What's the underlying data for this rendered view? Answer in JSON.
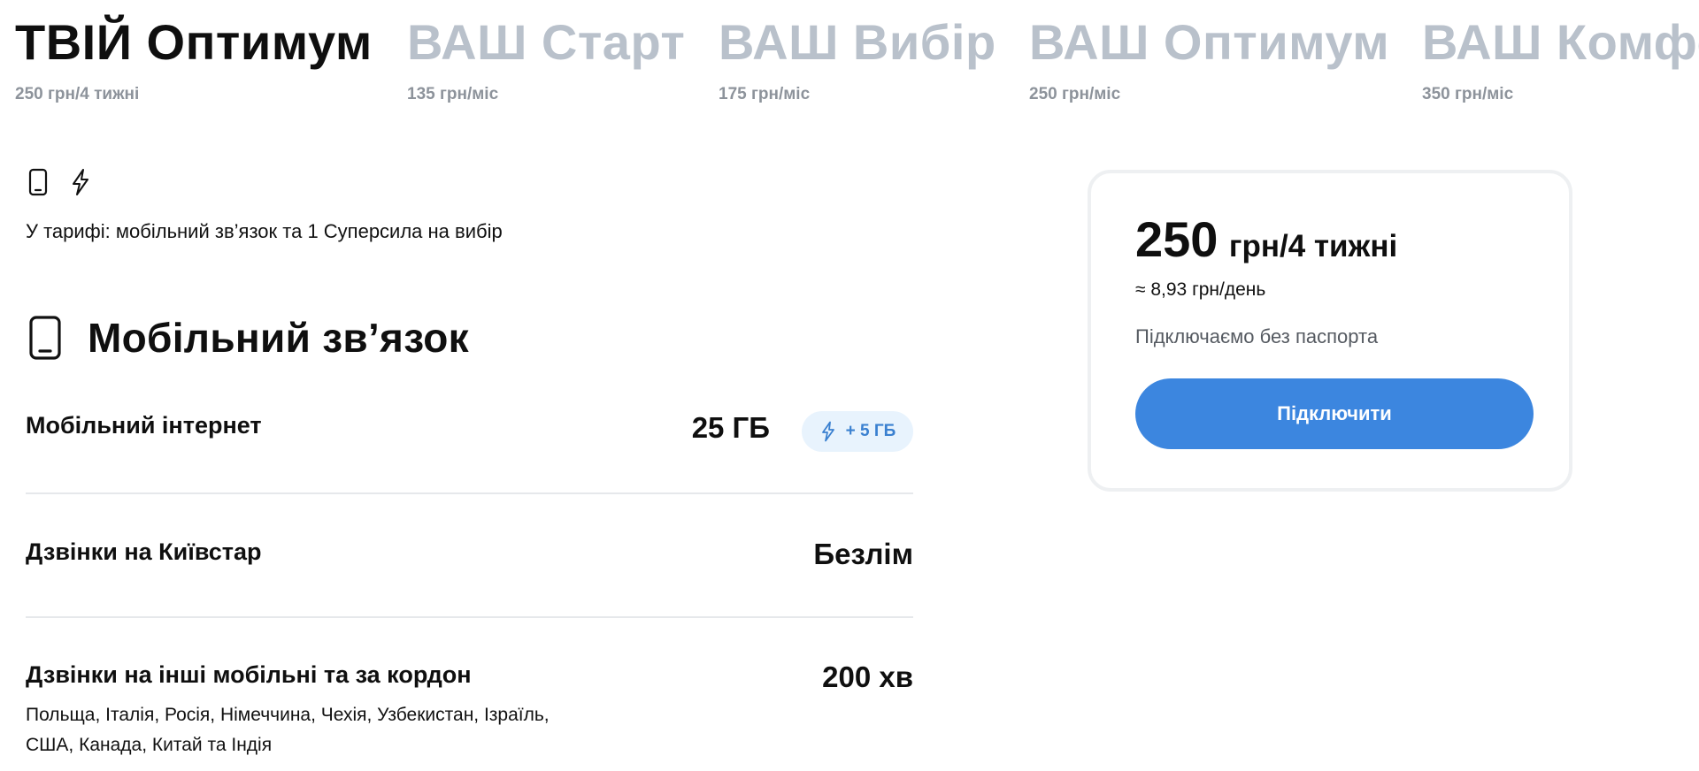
{
  "tabs": [
    {
      "name": "ТВІЙ Оптимум",
      "price": "250 грн/4 тижні",
      "active": true
    },
    {
      "name": "ВАШ Старт",
      "price": "135 грн/міс",
      "active": false
    },
    {
      "name": "ВАШ Вибір",
      "price": "175 грн/міс",
      "active": false
    },
    {
      "name": "ВАШ Оптимум",
      "price": "250 грн/міс",
      "active": false
    },
    {
      "name": "ВАШ Комфорт",
      "price": "350 грн/міс",
      "active": false
    }
  ],
  "features": {
    "icons": [
      "phone-icon",
      "bolt-icon"
    ],
    "text": "У тарифі: мобільний зв’язок та 1 Суперсила на вибір"
  },
  "section": {
    "icon": "phone-icon",
    "title": "Мобільний зв’язок"
  },
  "rows": [
    {
      "label": "Мобільний інтернет",
      "value": "25 ГБ",
      "bonus": {
        "icon": "bolt-icon",
        "text": "+ 5 ГБ"
      }
    },
    {
      "label": "Дзвінки на Київстар",
      "value": "Безлім"
    },
    {
      "label": "Дзвінки на інші мобільні та за кордон",
      "value": "200 хв",
      "sub_line1": "Польща, Італія, Росія, Німеччина, Чехія, Узбекистан, Ізраїль,",
      "sub_line2": "США, Канада, Китай та Індія"
    }
  ],
  "card": {
    "amount": "250",
    "unit": "грн/4 тижні",
    "per_day": "≈ 8,93 грн/день",
    "note": "Підключаємо без паспорта",
    "button": "Підключити"
  },
  "colors": {
    "accent": "#3c86df",
    "badge_bg": "#e8f3fd",
    "inactive_tab": "#b9c1cb",
    "divider": "#e6e8eb"
  }
}
